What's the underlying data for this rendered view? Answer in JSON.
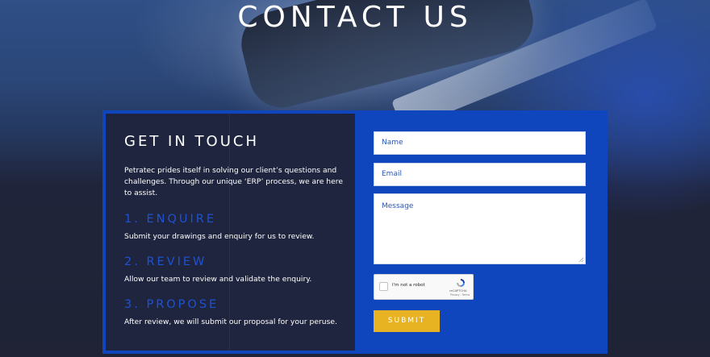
{
  "page": {
    "title": "CONTACT US"
  },
  "info": {
    "heading": "GET IN TOUCH",
    "intro": "Petratec prides itself in solving our client’s questions and challenges. Through our unique ‘ERP’ process, we are here to assist.",
    "steps": [
      {
        "heading": "1. ENQUIRE",
        "text": "Submit your drawings and enquiry for us to review."
      },
      {
        "heading": "2. REVIEW",
        "text": "Allow our team to review and validate the enquiry."
      },
      {
        "heading": "3. PROPOSE",
        "text": "After review, we will submit our proposal for your peruse."
      }
    ]
  },
  "form": {
    "name_placeholder": "Name",
    "email_placeholder": "Email",
    "message_placeholder": "Message",
    "captcha_label": "I'm not a robot",
    "captcha_brand": "reCAPTCHA",
    "captcha_terms": "Privacy - Terms",
    "submit_label": "SUBMIT"
  },
  "colors": {
    "accent_blue": "#0f45bd",
    "step_heading": "#1f52d1",
    "panel_dark": "#202438",
    "submit_yellow": "#e7b322"
  }
}
